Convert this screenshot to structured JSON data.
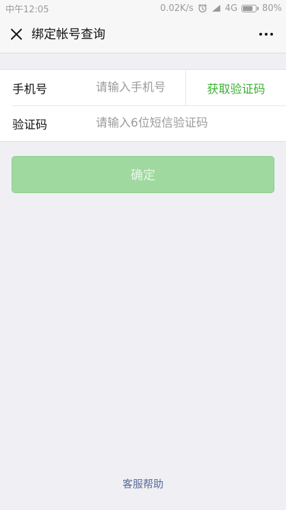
{
  "status_bar": {
    "time": "中午12:05",
    "network_speed": "0.02K/s",
    "network_type": "4G",
    "battery_percent": "80%",
    "battery_level": 0.8,
    "icons": [
      "alarm-icon",
      "signal-icon",
      "battery-icon"
    ]
  },
  "nav": {
    "title": "绑定帐号查询",
    "close_icon": "close-icon",
    "more_icon": "more-icon"
  },
  "form": {
    "phone": {
      "label": "手机号",
      "value": "",
      "placeholder": "请输入手机号"
    },
    "get_code_label": "获取验证码",
    "code": {
      "label": "验证码",
      "value": "",
      "placeholder": "请输入6位短信验证码"
    }
  },
  "confirm_label": "确定",
  "help_label": "客服帮助",
  "colors": {
    "accent_green": "#3cb034",
    "disabled_button": "#9fd99f",
    "link_blue": "#576b95",
    "background": "#efeff4"
  }
}
